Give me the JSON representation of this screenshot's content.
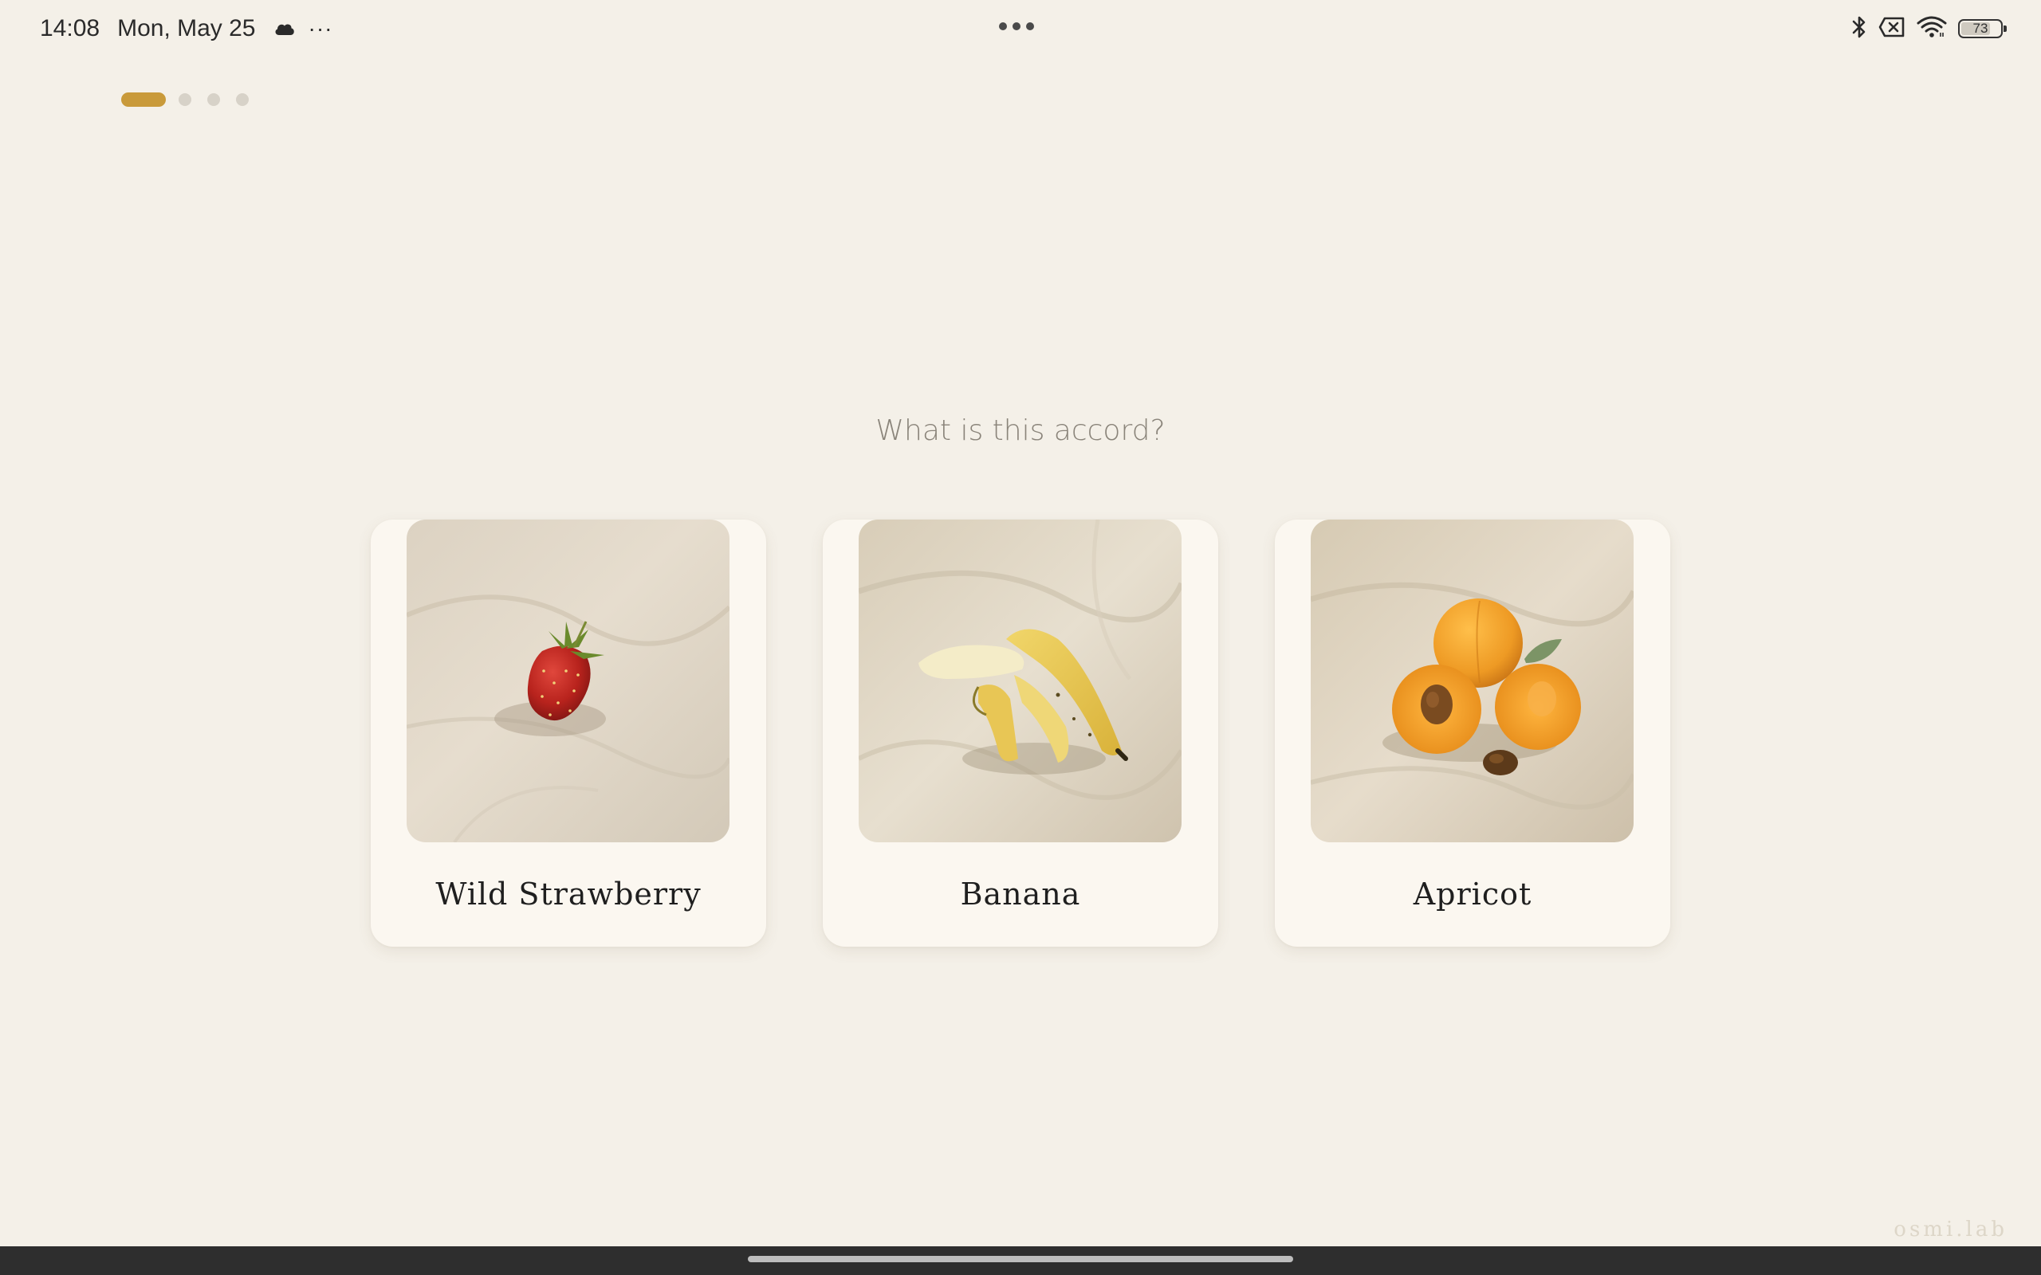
{
  "status_bar": {
    "time": "14:08",
    "date": "Mon, May 25",
    "more": "···",
    "battery_level": "73",
    "icons": [
      "cloud-icon",
      "bluetooth-icon",
      "sim-off-icon",
      "wifi-icon",
      "battery-icon"
    ]
  },
  "pager": {
    "total_pages": 4,
    "current_page": 1,
    "accent_color": "#c99a3a"
  },
  "quiz": {
    "question": "What is this accord?",
    "options": [
      {
        "label": "Wild Strawberry",
        "image": "strawberry-photo"
      },
      {
        "label": "Banana",
        "image": "banana-photo"
      },
      {
        "label": "Apricot",
        "image": "apricot-photo"
      }
    ]
  },
  "watermark": "osmi.lab",
  "colors": {
    "background": "#f4f0e8",
    "card": "#fbf7f0",
    "question_text": "#8a847a"
  }
}
